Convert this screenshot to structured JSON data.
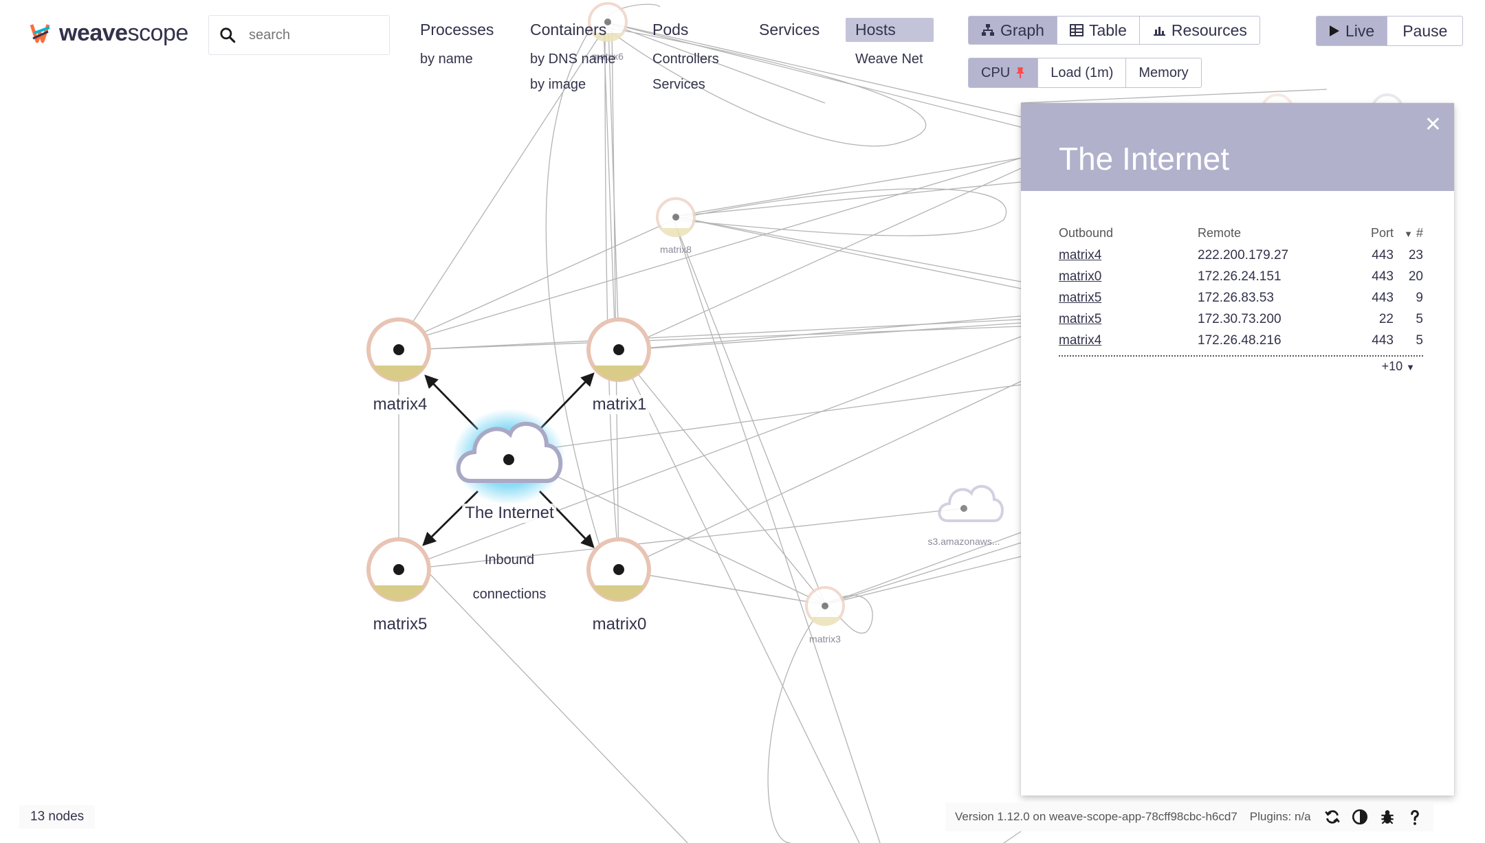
{
  "logo": {
    "brand_bold": "weave",
    "brand_light": "scope"
  },
  "search": {
    "placeholder": "search"
  },
  "topologies": [
    {
      "label": "Processes",
      "subs": [
        "by name"
      ]
    },
    {
      "label": "Containers",
      "subs": [
        "by DNS name",
        "by image"
      ]
    },
    {
      "label": "Pods",
      "subs": [
        "Controllers",
        "Services"
      ]
    },
    {
      "label": "Services",
      "subs": []
    },
    {
      "label": "Hosts",
      "active": true,
      "subs": [
        "Weave Net"
      ]
    }
  ],
  "view_modes": [
    {
      "label": "Graph",
      "icon": "sitemap-icon",
      "active": true
    },
    {
      "label": "Table",
      "icon": "table-icon",
      "active": false
    },
    {
      "label": "Resources",
      "icon": "bar-chart-icon",
      "active": false
    }
  ],
  "metrics": [
    {
      "label": "CPU",
      "active": true,
      "pinned": true
    },
    {
      "label": "Load (1m)",
      "active": false
    },
    {
      "label": "Memory",
      "active": false
    }
  ],
  "live_controls": [
    {
      "label": "Live",
      "icon": "play-icon",
      "active": true
    },
    {
      "label": "Pause",
      "active": false
    }
  ],
  "nodes": {
    "matrix4": "matrix4",
    "matrix1": "matrix1",
    "matrix5": "matrix5",
    "matrix0": "matrix0",
    "internet": "The Internet",
    "matrix8": "matrix8",
    "matrix6": "matrix6",
    "matrix3": "matrix3",
    "s3": "s3.amazonaws..."
  },
  "inbound_label": {
    "line1": "Inbound",
    "line2": "connections"
  },
  "details": {
    "title": "The Internet",
    "columns": {
      "outbound": "Outbound",
      "remote": "Remote",
      "port": "Port",
      "count": "#"
    },
    "rows": [
      {
        "node": "matrix4",
        "remote": "222.200.179.27",
        "port": "443",
        "count": "23"
      },
      {
        "node": "matrix0",
        "remote": "172.26.24.151",
        "port": "443",
        "count": "20"
      },
      {
        "node": "matrix5",
        "remote": "172.26.83.53",
        "port": "443",
        "count": "9"
      },
      {
        "node": "matrix5",
        "remote": "172.30.73.200",
        "port": "22",
        "count": "5"
      },
      {
        "node": "matrix4",
        "remote": "172.26.48.216",
        "port": "443",
        "count": "5"
      }
    ],
    "more": "+10"
  },
  "footer": {
    "node_count": "13 nodes",
    "version": "Version 1.12.0 on weave-scope-app-78cff98cbc-h6cd7",
    "plugins": "Plugins: n/a"
  },
  "colors": {
    "accent": "#b1b1cc",
    "node_ring": "#e8c4b4",
    "node_fill_cpu": "#d8cc88",
    "internet_glow": "#7fd8f5"
  }
}
